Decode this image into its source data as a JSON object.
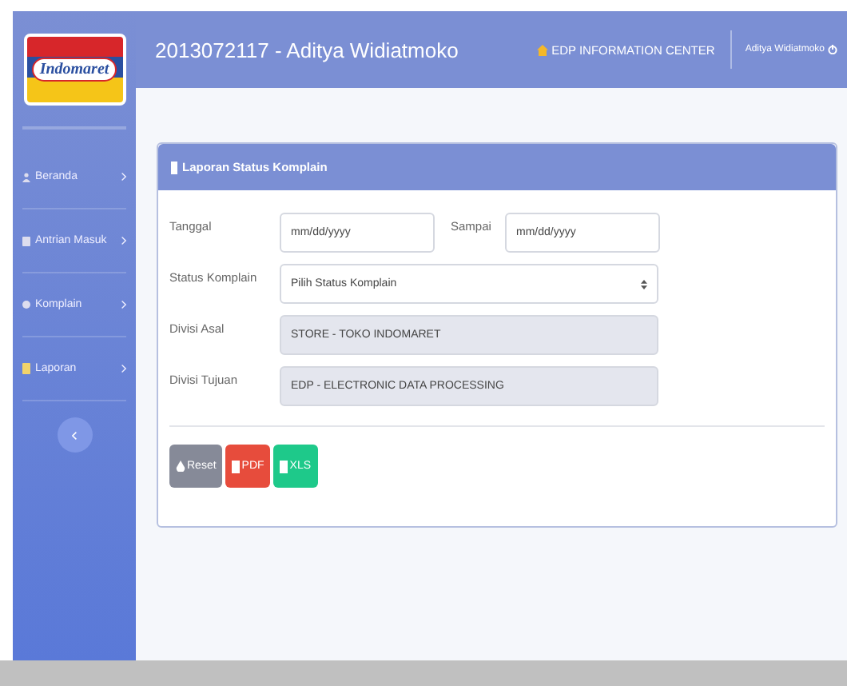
{
  "logo": {
    "text": "Indomaret"
  },
  "header": {
    "title": "2013072117 - Aditya Widiatmoko",
    "app_name": "EDP INFORMATION CENTER",
    "user": "Aditya Widiatmoko"
  },
  "sidebar": {
    "items": [
      {
        "label": "Beranda",
        "kind": "home"
      },
      {
        "label": "Antrian Masuk",
        "kind": "queue"
      },
      {
        "label": "Komplain",
        "kind": "complaint"
      },
      {
        "label": "Laporan",
        "kind": "report"
      }
    ]
  },
  "card": {
    "title": "Laporan Status Komplain",
    "rows": [
      {
        "kind": "dates",
        "label": "Tanggal",
        "placeholder": "mm/dd/yyyy",
        "label_2": "Sampai",
        "placeholder_2": "mm/dd/yyyy"
      },
      {
        "kind": "select",
        "label": "Status Komplain",
        "value": "Pilih Status Komplain"
      },
      {
        "kind": "readonly",
        "label": "Divisi Asal",
        "value": "STORE - TOKO INDOMARET"
      },
      {
        "kind": "readonly",
        "label": "Divisi Tujuan",
        "value": "EDP - ELECTRONIC DATA PROCESSING"
      }
    ],
    "buttons": [
      {
        "kind": "reset",
        "label": "Reset"
      },
      {
        "kind": "pdf",
        "label": "PDF"
      },
      {
        "kind": "xls",
        "label": "XLS"
      }
    ]
  }
}
